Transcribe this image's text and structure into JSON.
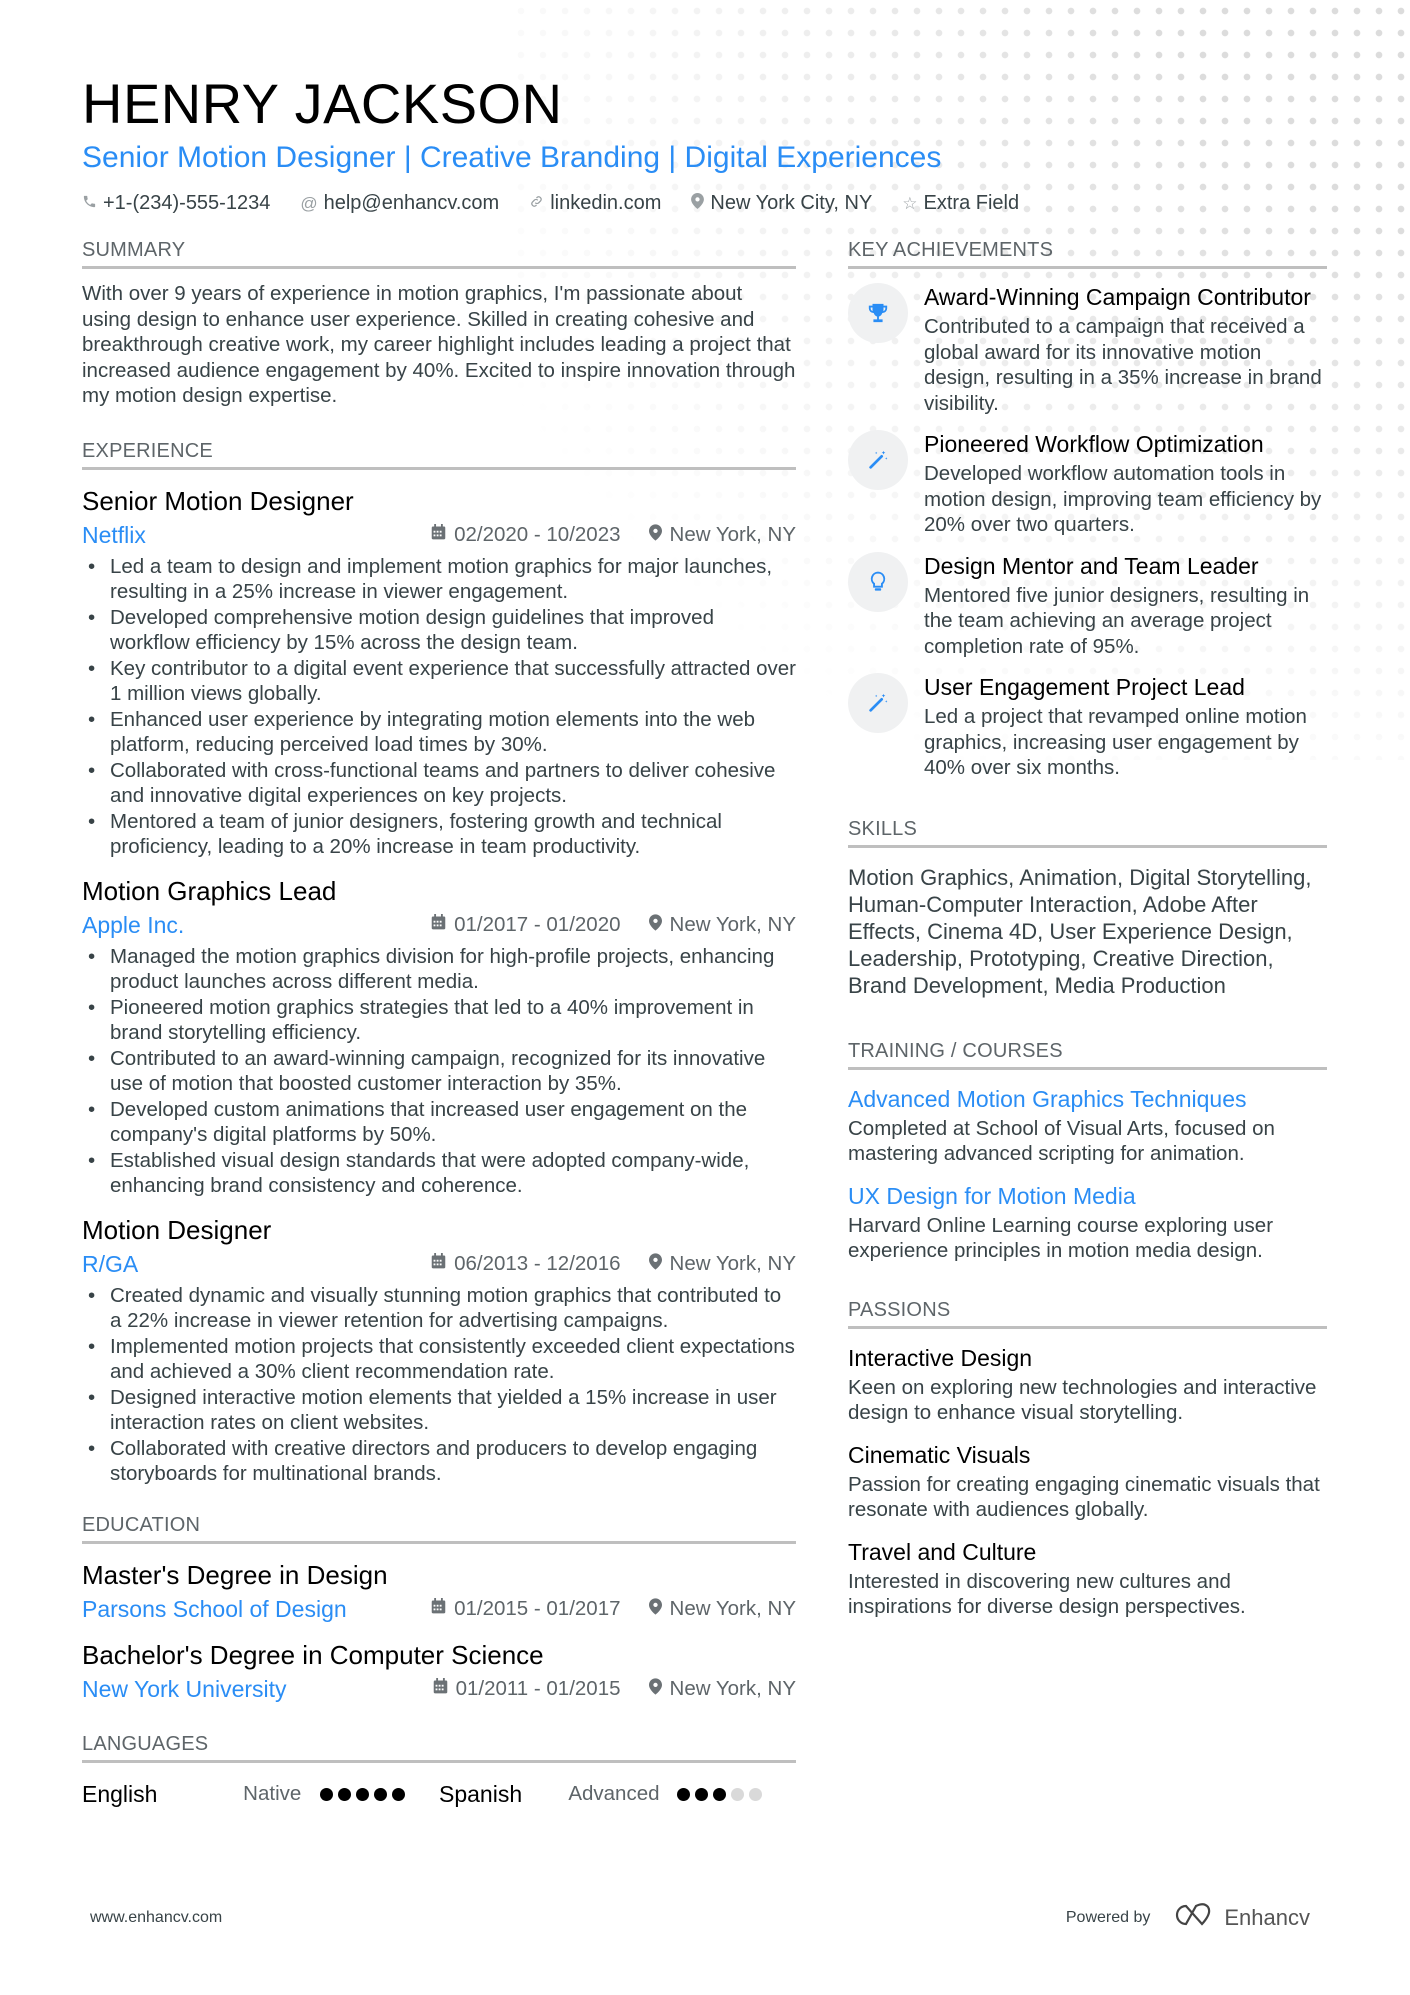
{
  "header": {
    "name": "HENRY JACKSON",
    "headline": "Senior Motion Designer | Creative Branding | Digital Experiences",
    "contacts": [
      {
        "icon": "phone-icon",
        "glyph": "✆",
        "text": "+1-(234)-555-1234"
      },
      {
        "icon": "at-icon",
        "glyph": "@",
        "text": "help@enhancv.com"
      },
      {
        "icon": "link-icon",
        "glyph": "🔗",
        "text": "linkedin.com"
      },
      {
        "icon": "location-icon",
        "glyph": "⬤",
        "text": "New York City, NY"
      },
      {
        "icon": "star-icon",
        "glyph": "☆",
        "text": "Extra Field"
      }
    ]
  },
  "summary": {
    "title": "SUMMARY",
    "text": "With over 9 years of experience in motion graphics, I'm passionate about using design to enhance user experience. Skilled in creating cohesive and breakthrough creative work, my career highlight includes leading a project that increased audience engagement by 40%. Excited to inspire innovation through my motion design expertise."
  },
  "experience": {
    "title": "EXPERIENCE",
    "jobs": [
      {
        "title": "Senior Motion Designer",
        "company": "Netflix",
        "dates": "02/2020 - 10/2023",
        "location": "New York, NY",
        "bullets": [
          "Led a team to design and implement motion graphics for major launches, resulting in a 25% increase in viewer engagement.",
          "Developed comprehensive motion design guidelines that improved workflow efficiency by 15% across the design team.",
          "Key contributor to a digital event experience that successfully attracted over 1 million views globally.",
          "Enhanced user experience by integrating motion elements into the web platform, reducing perceived load times by 30%.",
          "Collaborated with cross-functional teams and partners to deliver cohesive and innovative digital experiences on key projects.",
          "Mentored a team of junior designers, fostering growth and technical proficiency, leading to a 20% increase in team productivity."
        ]
      },
      {
        "title": "Motion Graphics Lead",
        "company": "Apple Inc.",
        "dates": "01/2017 - 01/2020",
        "location": "New York, NY",
        "bullets": [
          "Managed the motion graphics division for high-profile projects, enhancing product launches across different media.",
          "Pioneered motion graphics strategies that led to a 40% improvement in brand storytelling efficiency.",
          "Contributed to an award-winning campaign, recognized for its innovative use of motion that boosted customer interaction by 35%.",
          "Developed custom animations that increased user engagement on the company's digital platforms by 50%.",
          "Established visual design standards that were adopted company-wide, enhancing brand consistency and coherence."
        ]
      },
      {
        "title": "Motion Designer",
        "company": "R/GA",
        "dates": "06/2013 - 12/2016",
        "location": "New York, NY",
        "bullets": [
          "Created dynamic and visually stunning motion graphics that contributed to a 22% increase in viewer retention for advertising campaigns.",
          "Implemented motion projects that consistently exceeded client expectations and achieved a 30% client recommendation rate.",
          "Designed interactive motion elements that yielded a 15% increase in user interaction rates on client websites.",
          "Collaborated with creative directors and producers to develop engaging storyboards for multinational brands."
        ]
      }
    ]
  },
  "education": {
    "title": "EDUCATION",
    "items": [
      {
        "degree": "Master's Degree in Design",
        "school": "Parsons School of Design",
        "dates": "01/2015 - 01/2017",
        "location": "New York, NY"
      },
      {
        "degree": "Bachelor's Degree in Computer Science",
        "school": "New York University",
        "dates": "01/2011 - 01/2015",
        "location": "New York, NY"
      }
    ]
  },
  "languages": {
    "title": "LANGUAGES",
    "items": [
      {
        "name": "English",
        "level": "Native",
        "rating": 5,
        "max": 5
      },
      {
        "name": "Spanish",
        "level": "Advanced",
        "rating": 3,
        "max": 5
      }
    ]
  },
  "achievements": {
    "title": "KEY ACHIEVEMENTS",
    "items": [
      {
        "icon": "trophy-icon",
        "title": "Award-Winning Campaign Contributor",
        "desc": "Contributed to a campaign that received a global award for its innovative motion design, resulting in a 35% increase in brand visibility."
      },
      {
        "icon": "magic-wand-icon",
        "title": "Pioneered Workflow Optimization",
        "desc": "Developed workflow automation tools in motion design, improving team efficiency by 20% over two quarters."
      },
      {
        "icon": "lightbulb-icon",
        "title": "Design Mentor and Team Leader",
        "desc": "Mentored five junior designers, resulting in the team achieving an average project completion rate of 95%."
      },
      {
        "icon": "magic-wand-icon",
        "title": "User Engagement Project Lead",
        "desc": "Led a project that revamped online motion graphics, increasing user engagement by 40% over six months."
      }
    ]
  },
  "skills": {
    "title": "SKILLS",
    "text": "Motion Graphics, Animation, Digital Storytelling, Human-Computer Interaction, Adobe After Effects, Cinema 4D, User Experience Design, Leadership, Prototyping, Creative Direction, Brand Development, Media Production"
  },
  "training": {
    "title": "TRAINING / COURSES",
    "items": [
      {
        "title": "Advanced Motion Graphics Techniques",
        "desc": "Completed at School of Visual Arts, focused on mastering advanced scripting for animation."
      },
      {
        "title": "UX Design for Motion Media",
        "desc": "Harvard Online Learning course exploring user experience principles in motion media design."
      }
    ]
  },
  "passions": {
    "title": "PASSIONS",
    "items": [
      {
        "title": "Interactive Design",
        "desc": "Keen on exploring new technologies and interactive design to enhance visual storytelling."
      },
      {
        "title": "Cinematic Visuals",
        "desc": "Passion for creating engaging cinematic visuals that resonate with audiences globally."
      },
      {
        "title": "Travel and Culture",
        "desc": "Interested in discovering new cultures and inspirations for diverse design perspectives."
      }
    ]
  },
  "footer": {
    "website": "www.enhancv.com",
    "powered_by": "Powered by",
    "brand": "Enhancv"
  },
  "colors": {
    "accent": "#2a8df5",
    "text": "#384347",
    "heading": "#000000",
    "rule": "#bfbfbf"
  }
}
